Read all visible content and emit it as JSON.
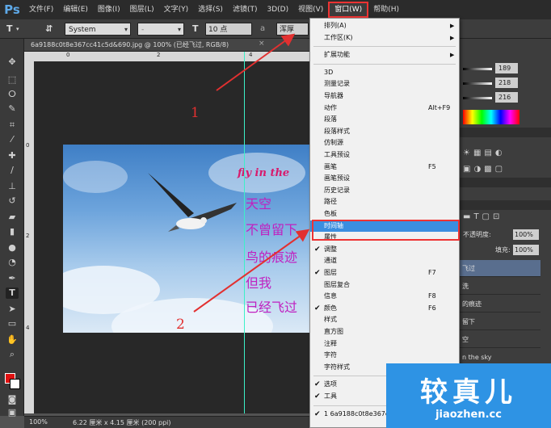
{
  "app": {
    "logo": "Ps"
  },
  "menubar": {
    "items": [
      "文件(F)",
      "编辑(E)",
      "图像(I)",
      "图层(L)",
      "文字(Y)",
      "选择(S)",
      "滤镜(T)",
      "3D(D)",
      "视图(V)",
      "窗口(W)",
      "帮助(H)"
    ],
    "active_index": 9
  },
  "options": {
    "tool_t": "T",
    "font_family": "System",
    "font_style": "-",
    "font_size": "10 点",
    "aa_label": "a",
    "aa_mode": "浑厚"
  },
  "document": {
    "tab_title": "6a9188c0t8e367cc41c5d&690.jpg @ 100% (已经飞过, RGB/8)",
    "close_label": "×",
    "ruler_h_labels": [
      "0",
      "2",
      "4"
    ],
    "ruler_v_labels": [
      "0",
      "2",
      "4"
    ]
  },
  "image_text": {
    "fly": "fly in the",
    "poem_lines": [
      "天空",
      "不曾留下",
      "鸟的痕迹",
      "但我",
      "已经飞过"
    ]
  },
  "status": {
    "zoom": "100%",
    "doc_info": "6.22 厘米 x 4.15 厘米 (200 ppi)"
  },
  "panels": {
    "rgb_values": [
      "189",
      "218",
      "216"
    ],
    "opacity_label": "不透明度:",
    "opacity_value": "100%",
    "fill_label": "填充:",
    "fill_value": "100%",
    "layer_rows": [
      "飞过",
      "洗",
      "的痕迹",
      "留下",
      "空",
      "n the sky"
    ]
  },
  "window_menu": {
    "items": [
      {
        "label": "排列(A)",
        "submenu": true
      },
      {
        "label": "工作区(K)",
        "submenu": true
      },
      {
        "sep": true
      },
      {
        "label": "扩展功能",
        "submenu": true
      },
      {
        "sep": true
      },
      {
        "label": "3D"
      },
      {
        "label": "测量记录"
      },
      {
        "label": "导航器"
      },
      {
        "label": "动作",
        "shortcut": "Alt+F9"
      },
      {
        "label": "段落"
      },
      {
        "label": "段落样式"
      },
      {
        "label": "仿制源"
      },
      {
        "label": "工具预设"
      },
      {
        "label": "画笔",
        "shortcut": "F5"
      },
      {
        "label": "画笔预设"
      },
      {
        "label": "历史记录"
      },
      {
        "label": "路径"
      },
      {
        "label": "色板"
      },
      {
        "label": "时间轴",
        "highlighted": true
      },
      {
        "label": "属性"
      },
      {
        "label": "调整",
        "checked": true
      },
      {
        "label": "通道"
      },
      {
        "label": "图层",
        "shortcut": "F7",
        "checked": true
      },
      {
        "label": "图层复合"
      },
      {
        "label": "信息",
        "shortcut": "F8"
      },
      {
        "label": "颜色",
        "shortcut": "F6",
        "checked": true
      },
      {
        "label": "样式"
      },
      {
        "label": "直方图"
      },
      {
        "label": "注释"
      },
      {
        "label": "字符"
      },
      {
        "label": "字符样式"
      },
      {
        "sep": true
      },
      {
        "label": "选项",
        "checked": true
      },
      {
        "label": "工具",
        "checked": true
      },
      {
        "sep": true
      },
      {
        "label": "1 6a9188c0t8e367cc41c5d",
        "checked": true
      }
    ]
  },
  "annotations": {
    "step1": "1",
    "step2": "2"
  },
  "watermark": {
    "big": "较真儿",
    "small": "jiaozhen.cc"
  },
  "colors": {
    "highlight": "#3b8ee0",
    "annotation": "#e23030",
    "foreground": "#e01111",
    "guide": "#3cf0c8"
  }
}
